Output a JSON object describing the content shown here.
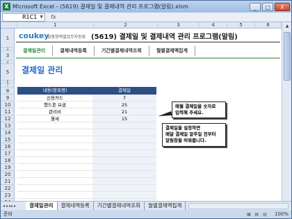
{
  "window": {
    "title": "Microsoft Excel - (5619) 결제일 및 결제내역 관리 프로그램(알림).xlsm",
    "app_icon": "X",
    "buttons": [
      "_",
      "□",
      "X"
    ]
  },
  "formula_bar": {
    "name_box": "R1C1",
    "fx": "fx"
  },
  "columns": [
    "1",
    "2",
    "3",
    "4",
    "5",
    "6"
  ],
  "rows": [
    "1",
    "2",
    "3",
    "4",
    "5",
    "6",
    "7",
    "8",
    "9",
    "10",
    "11",
    "12",
    "13",
    "14",
    "15",
    "16",
    "17",
    "18",
    "19",
    "20",
    "21",
    "22",
    "23",
    "24"
  ],
  "header": {
    "logo": "coukey",
    "logo_sub": "맞춤형엑셀업무자동화",
    "title": "(5619) 결제일 및 결제내역 관리 프로그램(알림)"
  },
  "menu": [
    "결제일관리",
    "결제내역등록",
    "기간별결제내역조회",
    "월별결제액집계"
  ],
  "section_title": "결제일 관리",
  "table": {
    "headers": [
      "내용(항목명)",
      "결제일"
    ],
    "rows": [
      [
        "신용카드",
        "7"
      ],
      [
        "핸드폰 요금",
        "25"
      ],
      [
        "관리비",
        "21"
      ],
      [
        "월세",
        "15"
      ],
      [
        "",
        ""
      ],
      [
        "",
        ""
      ],
      [
        "",
        ""
      ],
      [
        "",
        ""
      ],
      [
        "",
        ""
      ],
      [
        "",
        ""
      ],
      [
        "",
        ""
      ],
      [
        "",
        ""
      ],
      [
        "",
        ""
      ],
      [
        "",
        ""
      ],
      [
        "",
        ""
      ],
      [
        "",
        ""
      ]
    ]
  },
  "tips": {
    "tip1": [
      "매월 결제일을 숫자로",
      "입력해 주세요."
    ],
    "tip2": [
      "결제일을 설정하면",
      "매달 결제일 알주일 전부터",
      "알림창을 띄워줍니다."
    ]
  },
  "sheet_tabs": [
    "결제일관리",
    "결제내역등록",
    "기간별결제내역조회",
    "월별결제액집계"
  ],
  "status": {
    "ready": "준비",
    "zoom": "100%"
  }
}
